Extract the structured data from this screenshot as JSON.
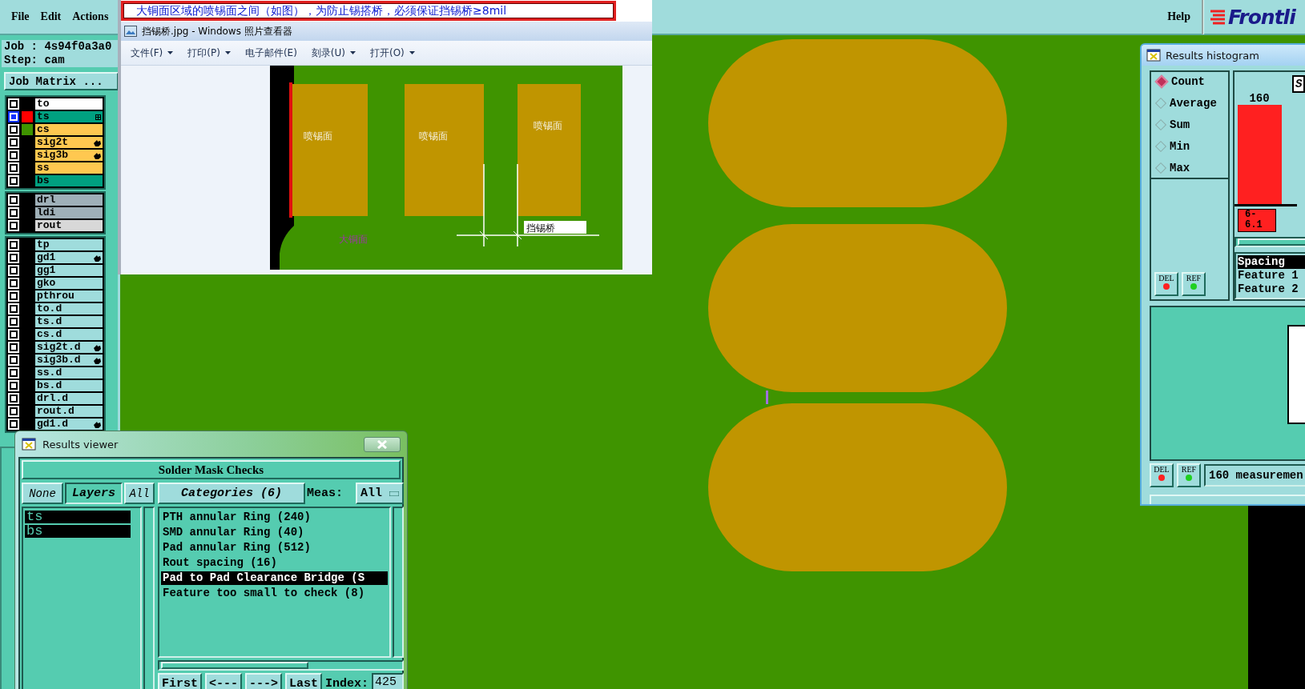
{
  "menu_bar": {
    "items": [
      {
        "label": "File"
      },
      {
        "label": "Edit"
      },
      {
        "label": "Actions"
      }
    ],
    "help": "Help",
    "logo": "Frontli"
  },
  "job_panel": {
    "job": "Job : 4s94f0a3a0",
    "step": "Step: cam",
    "matrix_button": "Job Matrix ...",
    "layer_groups": [
      {
        "layers": [
          {
            "name": "to",
            "color": "#ffffff",
            "selected": false,
            "kind": "plain"
          },
          {
            "name": "ts",
            "color": "#00a080",
            "selected": true,
            "swatch": {
              "color": "#ff0000"
            },
            "kind": "grid"
          },
          {
            "name": "cs",
            "color": "#ffc850",
            "selected": false,
            "swatch": {
              "color": "#3f9400"
            },
            "kind": "plain"
          },
          {
            "name": "sig2t",
            "color": "#ffc850",
            "selected": false,
            "kind": "hand"
          },
          {
            "name": "sig3b",
            "color": "#ffc850",
            "selected": false,
            "kind": "hand"
          },
          {
            "name": "ss",
            "color": "#ffc850",
            "selected": false,
            "kind": "plain"
          },
          {
            "name": "bs",
            "color": "#00a080",
            "selected": false,
            "kind": "plain"
          }
        ]
      },
      {
        "layers": [
          {
            "name": "drl",
            "color": "#9fb0b8",
            "selected": false,
            "kind": "plain"
          },
          {
            "name": "ldi",
            "color": "#9fb0b8",
            "selected": false,
            "kind": "plain"
          },
          {
            "name": "rout",
            "color": "#d8d8d8",
            "selected": false,
            "kind": "plain"
          }
        ]
      },
      {
        "layers": [
          {
            "name": "tp",
            "color": "#9fdcdc",
            "selected": false,
            "kind": "plain"
          },
          {
            "name": "gd1",
            "color": "#9fdcdc",
            "selected": false,
            "kind": "hand"
          },
          {
            "name": "gg1",
            "color": "#9fdcdc",
            "selected": false,
            "kind": "plain"
          },
          {
            "name": "gko",
            "color": "#9fdcdc",
            "selected": false,
            "kind": "plain"
          },
          {
            "name": "pthrou",
            "color": "#9fdcdc",
            "selected": false,
            "kind": "plain"
          },
          {
            "name": "to.d",
            "color": "#9fdcdc",
            "selected": false,
            "kind": "plain"
          },
          {
            "name": "ts.d",
            "color": "#9fdcdc",
            "selected": false,
            "kind": "plain"
          },
          {
            "name": "cs.d",
            "color": "#9fdcdc",
            "selected": false,
            "kind": "plain"
          },
          {
            "name": "sig2t.d",
            "color": "#9fdcdc",
            "selected": false,
            "kind": "hand"
          },
          {
            "name": "sig3b.d",
            "color": "#9fdcdc",
            "selected": false,
            "kind": "hand"
          },
          {
            "name": "ss.d",
            "color": "#9fdcdc",
            "selected": false,
            "kind": "plain"
          },
          {
            "name": "bs.d",
            "color": "#9fdcdc",
            "selected": false,
            "kind": "plain"
          },
          {
            "name": "drl.d",
            "color": "#9fdcdc",
            "selected": false,
            "kind": "plain"
          },
          {
            "name": "rout.d",
            "color": "#9fdcdc",
            "selected": false,
            "kind": "plain"
          },
          {
            "name": "gd1.d",
            "color": "#9fdcdc",
            "selected": false,
            "kind": "hand"
          }
        ]
      }
    ]
  },
  "photo_viewer": {
    "caption": "大铜面区域的喷锡面之间（如图），为防止锡搭桥，必须保证挡锡桥≥8mil",
    "title": "挡锡桥.jpg - Windows 照片查看器",
    "menu": [
      {
        "label": "文件(F)",
        "has_menu": true
      },
      {
        "label": "打印(P)",
        "has_menu": true
      },
      {
        "label": "电子邮件(E)",
        "has_menu": false
      },
      {
        "label": "刻录(U)",
        "has_menu": true
      },
      {
        "label": "打开(O)",
        "has_menu": true
      }
    ],
    "image": {
      "pad_labels": [
        "喷锡面",
        "喷锡面",
        "喷锡面"
      ],
      "bridge_label": "挡锡桥",
      "copper_label": "大铜面"
    }
  },
  "results_viewer": {
    "title": "Results viewer",
    "header": "Solder Mask Checks",
    "none_button": "None",
    "layers_label": "Layers",
    "all_button": "All",
    "layers": [
      {
        "name": "ts",
        "selected": true
      },
      {
        "name": "bs",
        "selected": true
      }
    ],
    "categories_label": "Categories (6)",
    "meas_label": "Meas:",
    "meas_value": "All",
    "categories": [
      {
        "label": "PTH annular Ring (240)",
        "selected": false
      },
      {
        "label": "SMD annular Ring (40)",
        "selected": false
      },
      {
        "label": "Pad annular Ring (512)",
        "selected": false
      },
      {
        "label": "Rout spacing (16)",
        "selected": false
      },
      {
        "label": "Pad to Pad Clearance Bridge (S",
        "selected": true
      },
      {
        "label": "Feature too small to check (8)",
        "selected": false
      }
    ],
    "nav": [
      "First",
      "<---",
      "--->",
      "Last"
    ],
    "index_label": "Index:",
    "index_value": "425"
  },
  "histogram": {
    "title": "Results histogram",
    "modes": [
      {
        "label": "Count",
        "selected": true
      },
      {
        "label": "Average",
        "selected": false
      },
      {
        "label": "Sum",
        "selected": false
      },
      {
        "label": "Min",
        "selected": false
      },
      {
        "label": "Max",
        "selected": false
      }
    ],
    "bins": [
      {
        "count": "160",
        "range": "6-6.1"
      }
    ],
    "corner_tab": "S",
    "info": [
      {
        "label": "Spacing",
        "selected": true
      },
      {
        "label": "Feature 1",
        "selected": false
      },
      {
        "label": "Feature 2",
        "selected": false
      }
    ],
    "top_actions": [
      {
        "label": "DEL",
        "color": "#ff2020"
      },
      {
        "label": "REF",
        "color": "#20d020"
      }
    ],
    "bottom_actions": [
      {
        "label": "DEL",
        "color": "#ff2020"
      },
      {
        "label": "REF",
        "color": "#20d020"
      }
    ],
    "status": "160 measuremen"
  }
}
